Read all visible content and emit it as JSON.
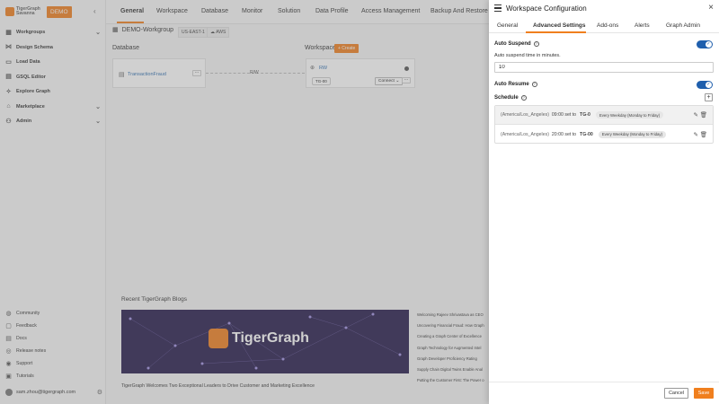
{
  "brand": {
    "name_line1": "TigerGraph",
    "name_line2": "Savanna",
    "badge": "DEMO",
    "accent": "#f07f1e"
  },
  "sidebar": {
    "collapse": "‹",
    "items": [
      {
        "label": "Workgroups",
        "icon": "workgroups-icon"
      },
      {
        "label": "Design Schema",
        "icon": "schema-icon"
      },
      {
        "label": "Load Data",
        "icon": "load-icon"
      },
      {
        "label": "GSQL Editor",
        "icon": "editor-icon"
      },
      {
        "label": "Explore Graph",
        "icon": "explore-icon"
      },
      {
        "label": "Marketplace",
        "icon": "marketplace-icon"
      },
      {
        "label": "Admin",
        "icon": "admin-icon"
      }
    ],
    "bottom_items": [
      {
        "label": "Community"
      },
      {
        "label": "Feedback"
      },
      {
        "label": "Docs"
      },
      {
        "label": "Release notes"
      },
      {
        "label": "Support"
      },
      {
        "label": "Tutorials"
      }
    ],
    "user_email": "sam.zhou@tigergraph.com"
  },
  "topnav": {
    "tabs": [
      "General",
      "Workspace",
      "Database",
      "Monitor",
      "Solution",
      "Data Profile",
      "Access Management",
      "Backup And Restore"
    ]
  },
  "workgroup": {
    "name": "DEMO-Workgroup",
    "region": "US-EAST-1",
    "cloud": "AWS",
    "database_label": "Database",
    "workspace_label": "Workspace",
    "create_label": "+ Create",
    "db_name": "TransactionFraud",
    "link_label": "R/W",
    "ws_name": "RW",
    "ws_size": "TG-00",
    "connect_label": "Connect ⌄"
  },
  "blogs": {
    "title": "Recent TigerGraph Blogs",
    "banner_text": "TigerGraph",
    "caption": "TigerGraph Welcomes Two Exceptional Leaders to Drive Customer and Marketing Excellence",
    "list": [
      "Welcoming Rajeev Shrivastava as CEO",
      "Uncovering Financial Fraud: How Graph",
      "Creating a Graph Center of Excellence",
      "Graph Technology for Augmented Intel",
      "Graph Developer Proficiency Rating",
      "Supply Chain Digital Twins Enable Anal",
      "Putting the Customer First: The Power o"
    ]
  },
  "drawer": {
    "title": "Workspace Configuration",
    "close": "×",
    "tabs": [
      "General",
      "Advanced Settings",
      "Add-ons",
      "Alerts",
      "Graph Admin"
    ],
    "active_tab": "Advanced Settings",
    "auto_suspend": {
      "label": "Auto Suspend",
      "enabled": true,
      "sub_label": "Auto suspend time in minutes.",
      "value": "10"
    },
    "auto_resume": {
      "label": "Auto Resume",
      "enabled": true
    },
    "schedule": {
      "label": "Schedule",
      "add": "+",
      "rows": [
        {
          "timezone": "(America/Los_Angeles)",
          "time": "09:00 set to",
          "size": "TG-0",
          "frequency": "Every Weekday (Monday to Friday)"
        },
        {
          "timezone": "(America/Los_Angeles)",
          "time": "20:00 set to",
          "size": "TG-00",
          "frequency": "Every Weekday (Monday to Friday)"
        }
      ]
    },
    "cancel_label": "Cancel",
    "save_label": "Save",
    "toggle_color": "#1f5fad"
  }
}
